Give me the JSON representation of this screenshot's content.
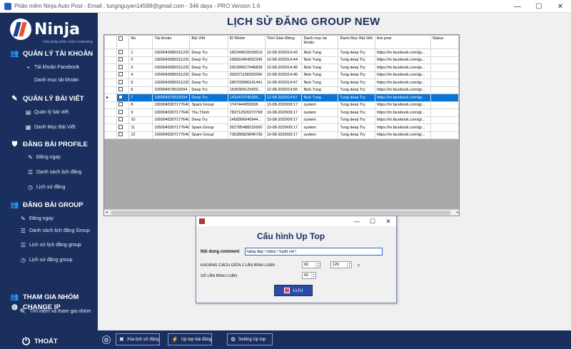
{
  "window": {
    "title": "Phần mềm Ninja Auto Post - Email : tungnguyen14598@gmail.com - 346 days  - PRO Version 1.6",
    "controls": [
      "—",
      "☐",
      "✕"
    ]
  },
  "logo": {
    "word": "Ninja",
    "tagline": "Giải pháp phần mềm marketing"
  },
  "sidebar": {
    "sections": [
      {
        "label": "QUẢN LÝ TÀI KHOẢN",
        "icon": "users-icon",
        "glyph": "👥",
        "items": [
          {
            "label": "Tài khoản Facebook",
            "glyph": "▪"
          },
          {
            "label": "Danh mục tài khoản",
            "glyph": ""
          }
        ]
      },
      {
        "label": "QUẢN LÝ BÀI VIẾT",
        "icon": "edit-icon",
        "glyph": "✎",
        "items": [
          {
            "label": "Quản lý bài viết",
            "glyph": "▤"
          },
          {
            "label": "Danh Mục Bài Viết",
            "glyph": "▦"
          }
        ]
      },
      {
        "label": "ĐĂNG BÀI PROFILE",
        "icon": "shield-icon",
        "glyph": "⛊",
        "items": [
          {
            "label": "Đăng ngay",
            "glyph": "✎"
          },
          {
            "label": "Danh sách lịch đăng",
            "glyph": "☰"
          },
          {
            "label": "Lịch sử đăng",
            "glyph": "◷"
          }
        ]
      },
      {
        "label": "ĐĂNG BÀI GROUP",
        "icon": "group-icon",
        "glyph": "👥",
        "items": [
          {
            "label": "Đăng ngay",
            "glyph": "✎"
          },
          {
            "label": "Danh sách lịch đăng Group",
            "glyph": "☰"
          },
          {
            "label": "Lịch sử lịch đăng group",
            "glyph": "☰"
          },
          {
            "label": "Lịch sử đăng group",
            "glyph": "◷"
          }
        ]
      },
      {
        "label": "THAM GIA NHÓM",
        "icon": "people-icon",
        "glyph": "👥",
        "items": [
          {
            "label": "Tìm kiếm và tham gia nhóm",
            "glyph": "🔍"
          }
        ]
      },
      {
        "label": "CHANGE IP",
        "icon": "globe-icon",
        "glyph": "◍",
        "items": []
      }
    ],
    "logout": {
      "label": "THOÁT",
      "glyph": "⏻"
    }
  },
  "page": {
    "title": "LỊCH SỬ ĐĂNG GROUP NEW"
  },
  "table": {
    "columns": [
      "",
      "No",
      "Tài khoản",
      "Bài Viết",
      "ID Nhóm",
      "Thời Gian Đăng",
      "Danh mục tài khoản",
      "Danh Mục Bài Viết",
      "link post",
      "Status"
    ],
    "column_widths": [
      17,
      18,
      34,
      52,
      54,
      52,
      52,
      52,
      52,
      78,
      40
    ],
    "selected_row": 6,
    "rows": [
      [
        "1",
        "100004308915122G",
        "Deep Try",
        "182249615539519",
        "12-08-2020\\14:43",
        "Nick Tung",
        "Tung deep Try",
        "https://m.facebook.com/gr...",
        ""
      ],
      [
        "2",
        "100004308915122G",
        "Deep Try",
        "195810404202245",
        "12-08-2020\\14:44",
        "Nick Tung",
        "Tung deep Try",
        "https://m.facebook.com/gr...",
        ""
      ],
      [
        "3",
        "100004308915122G",
        "Deep Try",
        "292399627445838",
        "12-08-2020\\14:45",
        "Nick Tung",
        "Tung deep Try",
        "https://m.facebook.com/gr...",
        ""
      ],
      [
        "4",
        "100004308915122G",
        "Deep Try",
        "303371106920294",
        "12-08-2020\\14:46",
        "Nick Tung",
        "Tung deep Try",
        "https://m.facebook.com/gr...",
        ""
      ],
      [
        "5",
        "100004308915122G",
        "Deep Try",
        "280703996141441",
        "12-08-2020\\14:47",
        "Nick Tung",
        "Tung deep Try",
        "https://m.facebook.com/gr...",
        ""
      ],
      [
        "6",
        "100004579533294",
        "Deep Try",
        "1535304123429...",
        "12-08-2020\\14:56",
        "Nick Tung",
        "Tung deep Try",
        "https://m.facebook.com/gr...",
        ""
      ],
      [
        "7",
        "100004579533294",
        "Deep Try",
        "1415473745399...",
        "12-08-2020\\14:57",
        "Nick Tung",
        "Tung deep Try",
        "https://m.facebook.com/gr...",
        ""
      ],
      [
        "8",
        "100004530717764G",
        "Spam Group",
        "1747444955568",
        "13-08-2020\\09:17",
        "system",
        "Tung deep Try",
        "https://m.facebook.com/gr...",
        ""
      ],
      [
        "9",
        "100004530717764G",
        "Thu Thính",
        "783712526372768",
        "13-08-2020\\09:17",
        "system",
        "Tung deep Try",
        "https://m.facebook.com/gr...",
        ""
      ],
      [
        "10",
        "100004530717764G",
        "Deep Try",
        "1458306640944...",
        "13-08-2020\\09:17",
        "system",
        "Tung deep Try",
        "https://m.facebook.com/gr...",
        ""
      ],
      [
        "11",
        "100004530717764G",
        "Spam Group",
        "352785488232690",
        "13-08-2020\\09:17",
        "system",
        "Tung deep Try",
        "https://m.facebook.com/gr...",
        ""
      ],
      [
        "12",
        "100004530717764G",
        "Spam Group",
        "736280829840736",
        "13-08-2020\\09:17",
        "system",
        "Tung deep Try",
        "https://m.facebook.com/gr...",
        ""
      ]
    ]
  },
  "dialog": {
    "title": "Cấu hình Up Top",
    "comment_label": "Nội dung comment",
    "comment_value": "hàng đẹp ! inbox ! tuyệt vời !",
    "interval_label": "KHOẢNG CÁCH GIỮA 2 LẦN BÌNH LUẬN",
    "interval_min": "60",
    "interval_max": "120",
    "interval_unit": "s",
    "count_label": "SỐ LẦN BÌNH LUẬN",
    "count_value": "60",
    "save_label": "LƯU"
  },
  "bottombar": {
    "delete_label": "Xóa lịch sử đăng",
    "uptop_label": "Up top bài đăng",
    "setting_label": "Setting Up top"
  },
  "colors": {
    "sidebar": "#1a2f5e",
    "selection": "#0a74d4",
    "accent": "#e7512b"
  }
}
